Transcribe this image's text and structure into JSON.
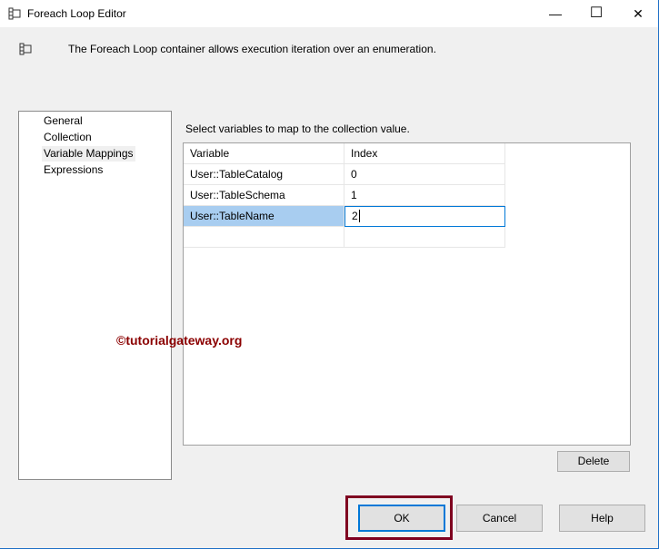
{
  "window": {
    "title": "Foreach Loop Editor",
    "minimize": "—",
    "maximize": "☐",
    "close": "✕"
  },
  "description": "The Foreach Loop container allows execution iteration over an enumeration.",
  "nav": {
    "items": [
      {
        "label": "General"
      },
      {
        "label": "Collection"
      },
      {
        "label": "Variable Mappings"
      },
      {
        "label": "Expressions"
      }
    ],
    "selected": "Variable Mappings"
  },
  "instructions": "Select variables to map to the collection value.",
  "grid": {
    "headers": [
      "Variable",
      "Index"
    ],
    "rows": [
      [
        "User::TableCatalog",
        "0"
      ],
      [
        "User::TableSchema",
        "1"
      ],
      [
        "User::TableName",
        "2"
      ]
    ]
  },
  "watermark": "©tutorialgateway.org",
  "buttons": {
    "delete": "Delete",
    "ok": "OK",
    "cancel": "Cancel",
    "help": "Help"
  },
  "colors": {
    "selection": "#a8cdf0",
    "focus": "#0078d7",
    "highlight_box": "#7f0020"
  }
}
